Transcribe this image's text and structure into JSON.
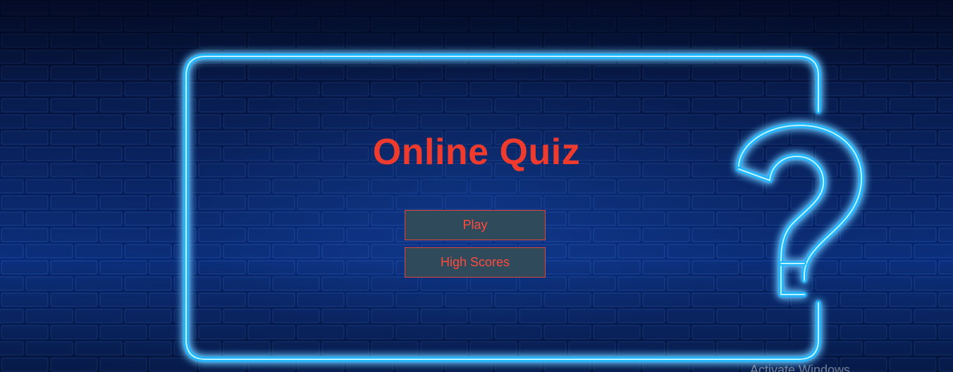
{
  "app": {
    "title": "Online Quiz"
  },
  "menu": {
    "play_label": "Play",
    "high_scores_label": "High Scores"
  },
  "background": {
    "decoration": "neon-question-mark-frame",
    "neon_color": "#2fc8ff",
    "brick_color": "#0a2f7a"
  },
  "overlay": {
    "watermark_text": "Activate Windows"
  },
  "colors": {
    "title": "#ef3b2d",
    "button_bg": "#2f4a5a",
    "button_border": "#e0443a",
    "button_text": "#ff4a3d"
  }
}
